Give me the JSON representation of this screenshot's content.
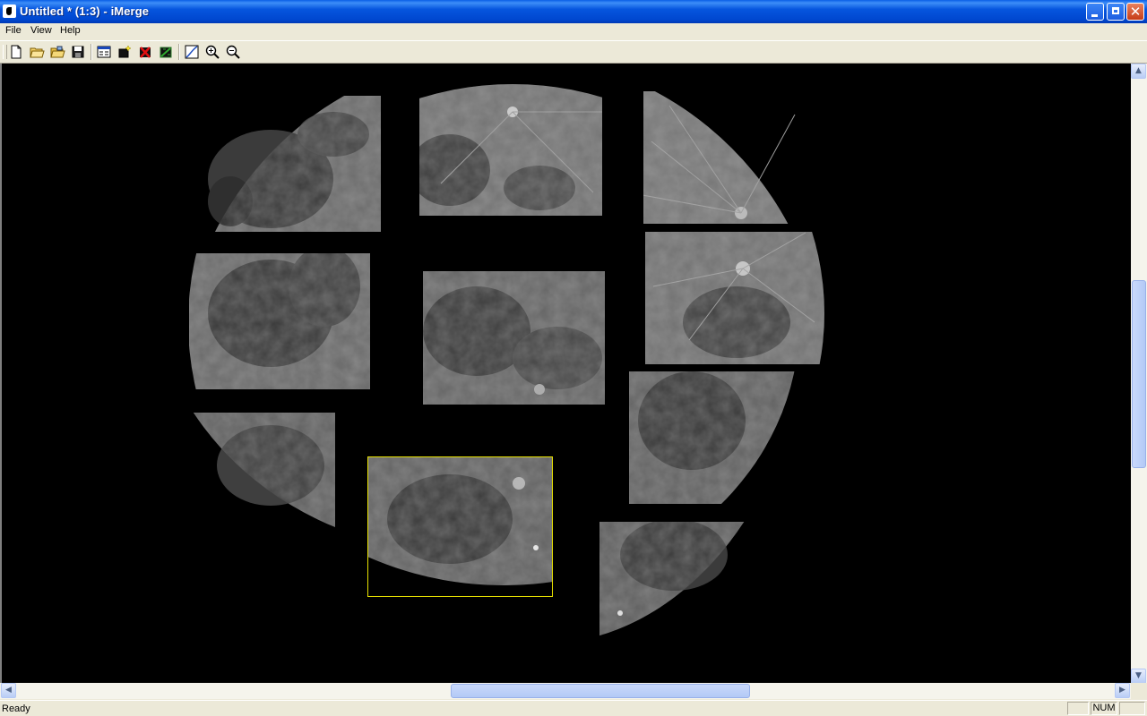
{
  "window": {
    "title": "Untitled * (1:3) - iMerge"
  },
  "menu": [
    "File",
    "View",
    "Help"
  ],
  "toolbar": {
    "buttons": [
      "new-file-icon",
      "open-folder-icon",
      "open-images-icon",
      "save-icon",
      "properties-icon",
      "add-image-icon",
      "remove-image-icon",
      "merge-image-icon",
      "curve-icon",
      "zoom-in-icon",
      "zoom-out-icon"
    ]
  },
  "status": {
    "text": "Ready",
    "num": "NUM"
  },
  "colors": {
    "selection": "#e6e000",
    "canvas": "#000000",
    "title": "#0055e5"
  },
  "tiles": [
    {
      "name": "moon-tile-top-left",
      "selected": false
    },
    {
      "name": "moon-tile-top-center",
      "selected": false
    },
    {
      "name": "moon-tile-top-right",
      "selected": false
    },
    {
      "name": "moon-tile-middle-left",
      "selected": false
    },
    {
      "name": "moon-tile-center",
      "selected": false
    },
    {
      "name": "moon-tile-middle-right",
      "selected": false
    },
    {
      "name": "moon-tile-lower-right",
      "selected": false
    },
    {
      "name": "moon-tile-bottom-left",
      "selected": false
    },
    {
      "name": "moon-tile-bottom-center",
      "selected": true
    },
    {
      "name": "moon-tile-bottom-right",
      "selected": false
    }
  ]
}
